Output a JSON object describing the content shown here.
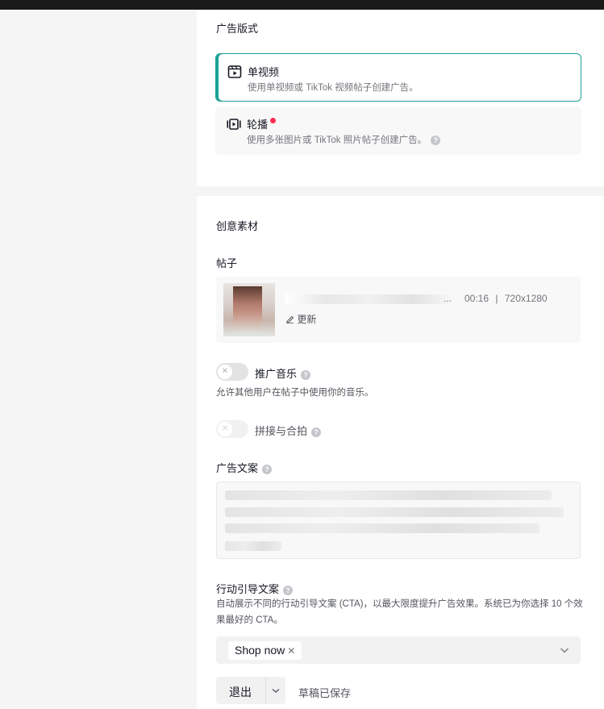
{
  "ad_format": {
    "title": "广告版式",
    "options": [
      {
        "label": "单视频",
        "description": "使用单视频或 TikTok 视频帖子创建广告。",
        "selected": true,
        "icon": "video-icon"
      },
      {
        "label": "轮播",
        "description": "使用多张图片或 TikTok 照片帖子创建广告。",
        "selected": false,
        "icon": "carousel-icon",
        "new_badge": true
      }
    ]
  },
  "creative": {
    "title": "创意素材",
    "post": {
      "label": "帖子",
      "duration": "00:16",
      "separator": "|",
      "resolution": "720x1280",
      "ellipsis": "...",
      "update_label": "更新"
    },
    "promote_music": {
      "label": "推广音乐",
      "enabled": false,
      "hint": "允许其他用户在帖子中使用你的音乐。"
    },
    "stitch_duet": {
      "label": "拼接与合拍",
      "enabled": false,
      "disabled": true
    },
    "ad_copy": {
      "label": "广告文案"
    },
    "cta": {
      "label": "行动引导文案",
      "hint": "自动展示不同的行动引导文案 (CTA)，以最大限度提升广告效果。系统已为你选择 10 个效果最好的 CTA。",
      "selected_chips": [
        "Shop now"
      ]
    }
  },
  "footer": {
    "exit_label": "退出",
    "saved_status": "草稿已保存"
  },
  "colors": {
    "accent": "#1aa094",
    "new_dot": "#fe2c55"
  }
}
